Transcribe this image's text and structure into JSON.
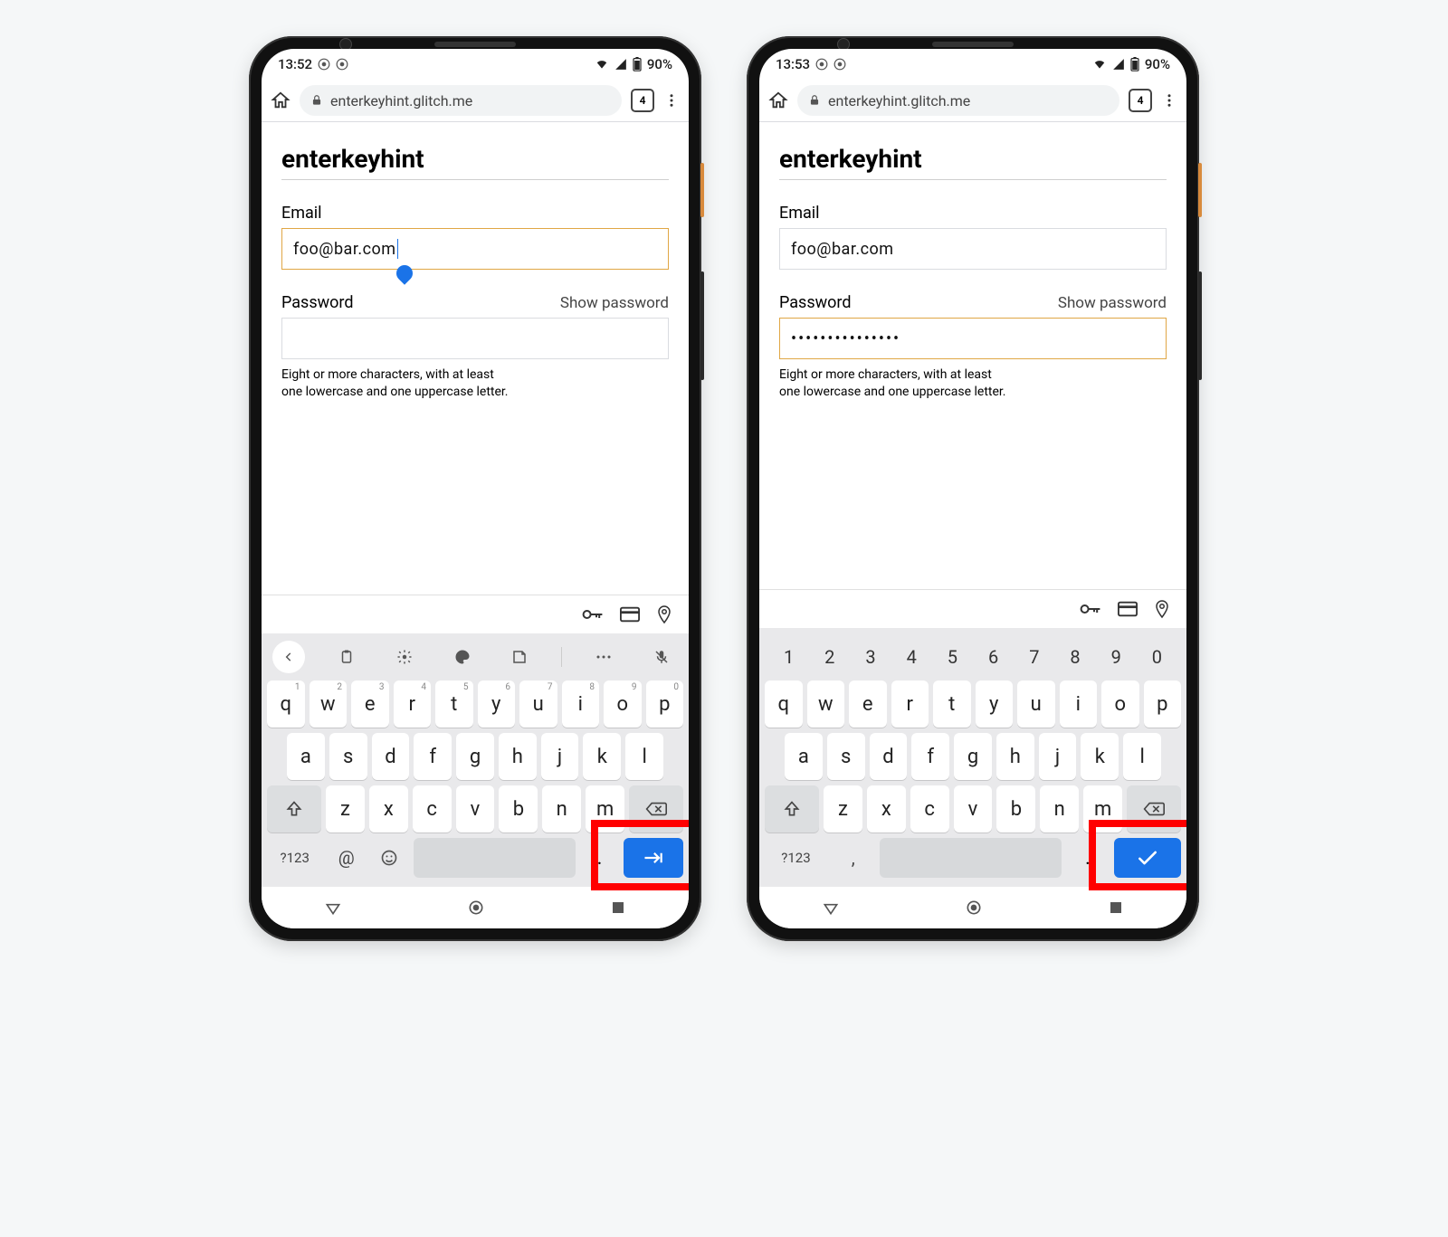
{
  "phones": [
    {
      "status_time": "13:52",
      "status_battery": "90%",
      "url": "enterkeyhint.glitch.me",
      "tab_count": "4",
      "page_title": "enterkeyhint",
      "email_label": "Email",
      "email_value": "foo@bar.com",
      "email_active": true,
      "password_label": "Password",
      "show_password_label": "Show password",
      "password_value": "",
      "password_active": false,
      "hint_line1": "Eight or more characters, with at least",
      "hint_line2": "one lowercase and one uppercase letter.",
      "keyboard_variant": "email",
      "enter_icon": "next",
      "row1": [
        {
          "k": "q",
          "s": "1"
        },
        {
          "k": "w",
          "s": "2"
        },
        {
          "k": "e",
          "s": "3"
        },
        {
          "k": "r",
          "s": "4"
        },
        {
          "k": "t",
          "s": "5"
        },
        {
          "k": "y",
          "s": "6"
        },
        {
          "k": "u",
          "s": "7"
        },
        {
          "k": "i",
          "s": "8"
        },
        {
          "k": "o",
          "s": "9"
        },
        {
          "k": "p",
          "s": "0"
        }
      ],
      "row2": [
        "a",
        "s",
        "d",
        "f",
        "g",
        "h",
        "j",
        "k",
        "l"
      ],
      "row3": [
        "z",
        "x",
        "c",
        "v",
        "b",
        "n",
        "m"
      ],
      "sym_label": "?123",
      "extra_glyph": "@",
      "dot_label": "."
    },
    {
      "status_time": "13:53",
      "status_battery": "90%",
      "url": "enterkeyhint.glitch.me",
      "tab_count": "4",
      "page_title": "enterkeyhint",
      "email_label": "Email",
      "email_value": "foo@bar.com",
      "email_active": false,
      "password_label": "Password",
      "show_password_label": "Show password",
      "password_value": "•••••••••••••••",
      "password_active": true,
      "hint_line1": "Eight or more characters, with at least",
      "hint_line2": "one lowercase and one uppercase letter.",
      "keyboard_variant": "password",
      "enter_icon": "done",
      "num_row": [
        "1",
        "2",
        "3",
        "4",
        "5",
        "6",
        "7",
        "8",
        "9",
        "0"
      ],
      "row1": [
        {
          "k": "q"
        },
        {
          "k": "w"
        },
        {
          "k": "e"
        },
        {
          "k": "r"
        },
        {
          "k": "t"
        },
        {
          "k": "y"
        },
        {
          "k": "u"
        },
        {
          "k": "i"
        },
        {
          "k": "o"
        },
        {
          "k": "p"
        }
      ],
      "row2": [
        "a",
        "s",
        "d",
        "f",
        "g",
        "h",
        "j",
        "k",
        "l"
      ],
      "row3": [
        "z",
        "x",
        "c",
        "v",
        "b",
        "n",
        "m"
      ],
      "sym_label": "?123",
      "extra_glyph": ",",
      "dot_label": "."
    }
  ]
}
